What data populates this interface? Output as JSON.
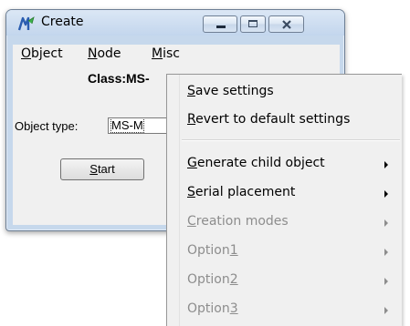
{
  "window": {
    "title": "Create",
    "menu": [
      {
        "pre": "",
        "ul": "O",
        "post": "bject"
      },
      {
        "pre": "",
        "ul": "N",
        "post": "ode"
      },
      {
        "pre": "",
        "ul": "M",
        "post": "isc"
      }
    ],
    "class_label": "Class:MS-",
    "object_type_label": "Object type:",
    "object_type_value": "MS-M",
    "start_button": {
      "ul": "S",
      "post": "tart"
    }
  },
  "popup": {
    "items": [
      {
        "pre": "",
        "ul": "S",
        "post": "ave settings"
      },
      {
        "pre": "",
        "ul": "R",
        "post": "evert to default settings"
      },
      {
        "pre": "",
        "ul": "G",
        "post": "enerate child object"
      },
      {
        "pre": "",
        "ul": "S",
        "post": "erial placement"
      },
      {
        "pre": "",
        "ul": "C",
        "post": "reation modes"
      },
      {
        "pre": "Option",
        "ul": "1",
        "post": ""
      },
      {
        "pre": "Option",
        "ul": "2",
        "post": ""
      },
      {
        "pre": "Option",
        "ul": "3",
        "post": ""
      }
    ]
  }
}
